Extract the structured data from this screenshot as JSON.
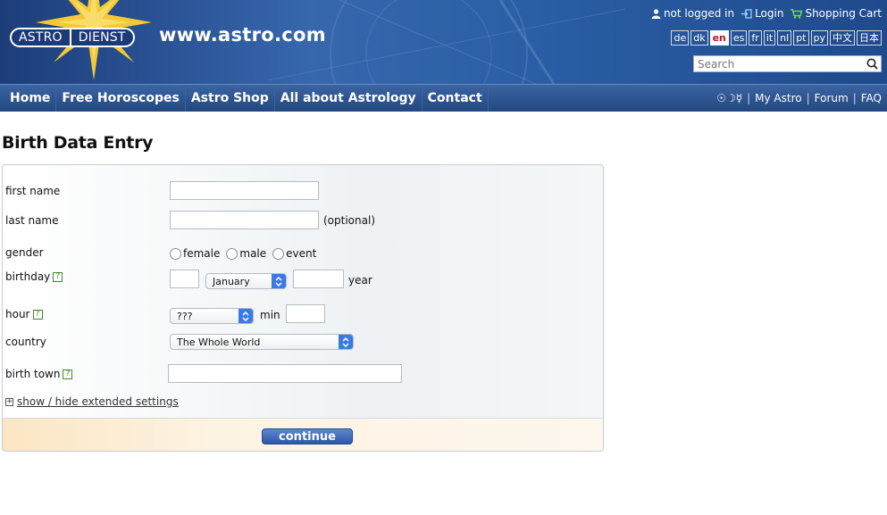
{
  "header": {
    "logo": [
      "ASTRO",
      "DIENST"
    ],
    "site_url": "www.astro.com",
    "user_status": "not logged in",
    "login": "Login",
    "cart": "Shopping Cart",
    "languages": [
      "de",
      "dk",
      "en",
      "es",
      "fr",
      "it",
      "nl",
      "pt",
      "py",
      "中文",
      "日本"
    ],
    "active_language": "en",
    "search_placeholder": "Search"
  },
  "nav": {
    "items": [
      "Home",
      "Free Horoscopes",
      "Astro Shop",
      "All about Astrology",
      "Contact"
    ],
    "right": {
      "symbols": "☉☽☿",
      "my_astro": "My Astro",
      "forum": "Forum",
      "faq": "FAQ",
      "separator": "|"
    }
  },
  "form": {
    "title": "Birth Data Entry",
    "first_name_label": "first name",
    "last_name_label": "last name",
    "optional": "(optional)",
    "gender_label": "gender",
    "gender_options": [
      "female",
      "male",
      "event"
    ],
    "birthday_label": "birthday",
    "month_value": "January",
    "year_label": "year",
    "hour_label": "hour",
    "hour_value": "???",
    "min_label": "min",
    "country_label": "country",
    "country_value": "The Whole World",
    "birth_town_label": "birth town",
    "help_glyph": "?",
    "extended_toggle": "show / hide extended settings",
    "expand_glyph": "+",
    "continue": "continue"
  },
  "colors": {
    "header_blue": "#2b5ea5",
    "nav_blue": "#24477f",
    "help_green": "#3d8a27",
    "button_blue": "#2c5aa8"
  }
}
